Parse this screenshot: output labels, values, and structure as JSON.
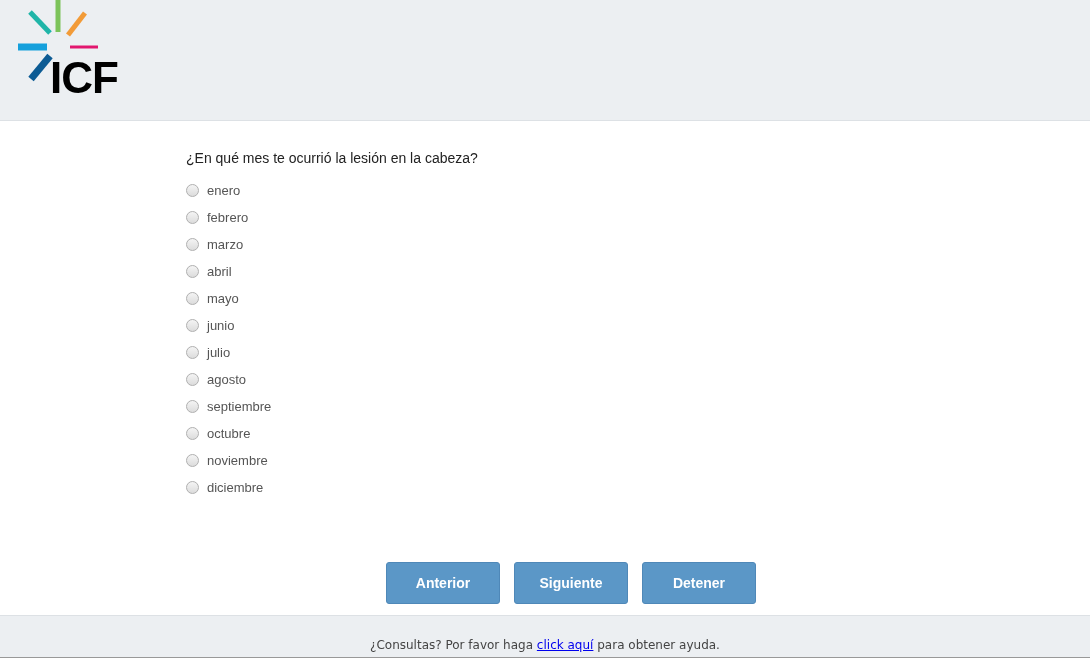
{
  "logo": {
    "text": "ICF"
  },
  "question": "¿En qué mes te ocurrió la lesión en la cabeza?",
  "options": [
    {
      "label": "enero",
      "selected": false
    },
    {
      "label": "febrero",
      "selected": false
    },
    {
      "label": "marzo",
      "selected": false
    },
    {
      "label": "abril",
      "selected": false
    },
    {
      "label": "mayo",
      "selected": false
    },
    {
      "label": "junio",
      "selected": false
    },
    {
      "label": "julio",
      "selected": false
    },
    {
      "label": "agosto",
      "selected": false
    },
    {
      "label": "septiembre",
      "selected": false
    },
    {
      "label": "octubre",
      "selected": false
    },
    {
      "label": "noviembre",
      "selected": false
    },
    {
      "label": "diciembre",
      "selected": false
    }
  ],
  "buttons": [
    "Anterior",
    "Siguiente",
    "Detener"
  ],
  "footer": {
    "before": "¿Consultas? Por favor haga ",
    "link": "click aquí",
    "after": " para obtener ayuda."
  }
}
